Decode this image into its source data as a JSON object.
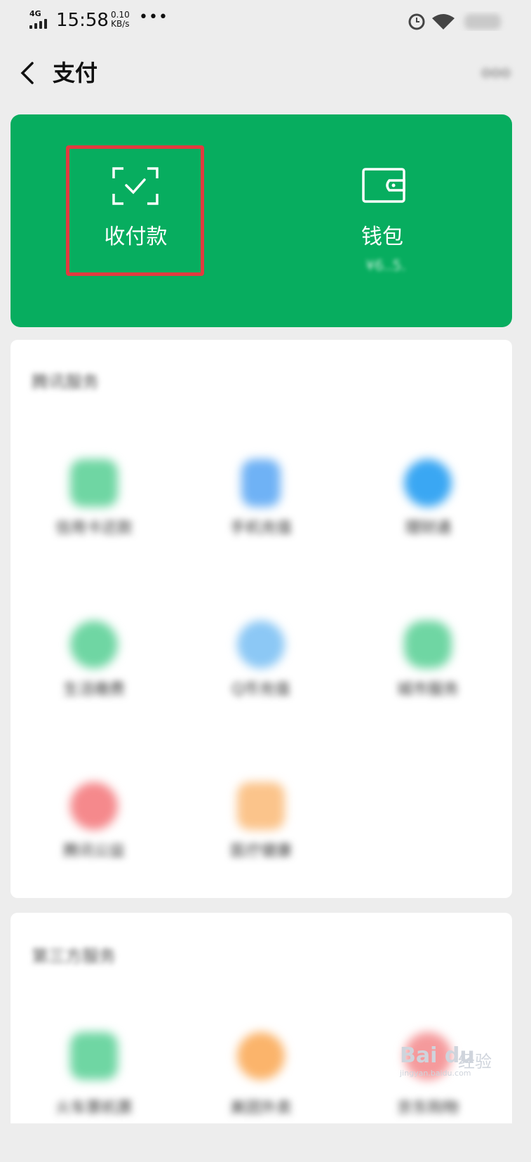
{
  "status_bar": {
    "network": "4G",
    "time": "15:58",
    "speed_value": "0.10",
    "speed_unit": "KB/s",
    "overflow": "•••"
  },
  "header": {
    "title": "支付",
    "back_icon": "chevron-left-icon",
    "more_icon": "more-dots-icon"
  },
  "payment_card": {
    "background": "#07ad5f",
    "highlight_color": "#e23a3f",
    "pay_receive_label": "收付款",
    "wallet_label": "钱包",
    "wallet_balance": "¥6..5."
  },
  "services_panel": {
    "title": "腾讯服务",
    "items": [
      {
        "label": "信用卡还款",
        "color": "#6fd6a3"
      },
      {
        "label": "手机充值",
        "color": "#6fb2f5"
      },
      {
        "label": "理财通",
        "color": "#3aa7f3"
      },
      {
        "label": "生活缴费",
        "color": "#6fd6a3"
      },
      {
        "label": "Q币充值",
        "color": "#8cc8f5"
      },
      {
        "label": "城市服务",
        "color": "#6fd6a3"
      },
      {
        "label": "腾讯公益",
        "color": "#f5898c"
      },
      {
        "label": "医疗健康",
        "color": "#fbc48b"
      }
    ]
  },
  "third_party_panel": {
    "title": "第三方服务",
    "items": [
      {
        "label": "火车票机票",
        "color": "#6fd6a3"
      },
      {
        "label": "美团外卖",
        "color": "#fbb46b"
      },
      {
        "label": "京东购物",
        "color": "#f59a9c"
      }
    ]
  },
  "watermark": {
    "logo": "Bai du",
    "text": "经验",
    "url": "jingyan.baidu.com"
  }
}
